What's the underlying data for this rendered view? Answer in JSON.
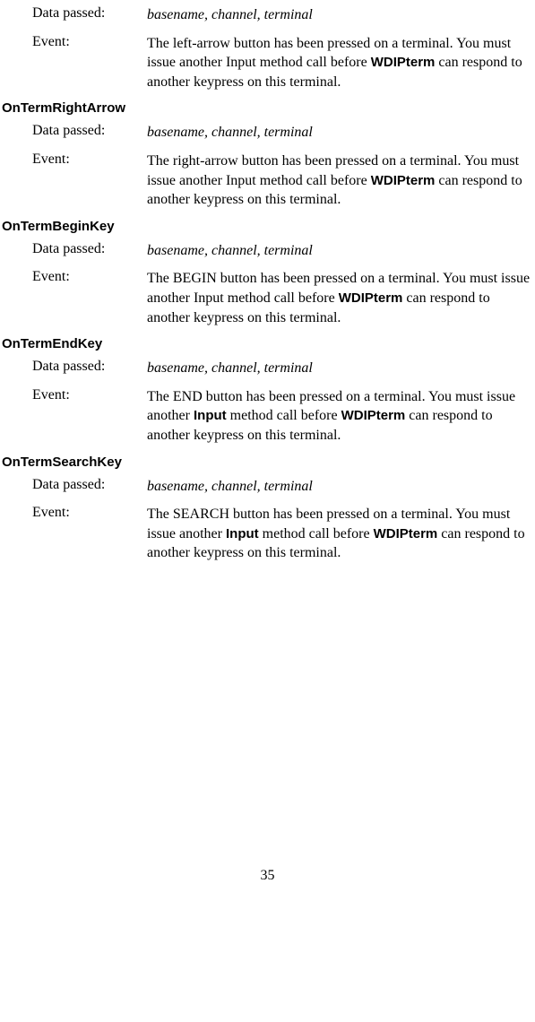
{
  "labels": {
    "data_passed": "Data passed:",
    "event": "Event:"
  },
  "data_passed_value": "basename, channel, terminal",
  "wdipterm": "WDIPterm",
  "input_word": "Input",
  "sections": [
    {
      "heading": null,
      "event_pre": "The left-arrow button has been pressed on a terminal. You must issue another Input method call before ",
      "event_post": " can respond to another keypress on this terminal.",
      "uses_input_sans": false
    },
    {
      "heading": "OnTermRightArrow",
      "event_pre": "The right-arrow button has been pressed on a terminal. You must issue another Input method call before ",
      "event_post": " can respond to another keypress on this terminal.",
      "uses_input_sans": false
    },
    {
      "heading": "OnTermBeginKey",
      "event_pre": "The BEGIN button has been pressed on a terminal. You must issue another Input method call before ",
      "event_post": " can respond to another keypress on this terminal.",
      "uses_input_sans": false
    },
    {
      "heading": "OnTermEndKey",
      "event_pre1": "The END button has been pressed on a terminal. You must issue another ",
      "event_mid": " method call before ",
      "event_post": " can respond to another keypress on this terminal.",
      "uses_input_sans": true
    },
    {
      "heading": "OnTermSearchKey",
      "event_pre1": "The SEARCH button has been pressed on a terminal. You must issue another ",
      "event_mid": " method call before ",
      "event_post": " can respond to another keypress on this terminal.",
      "uses_input_sans": true
    }
  ],
  "page_number": "35"
}
